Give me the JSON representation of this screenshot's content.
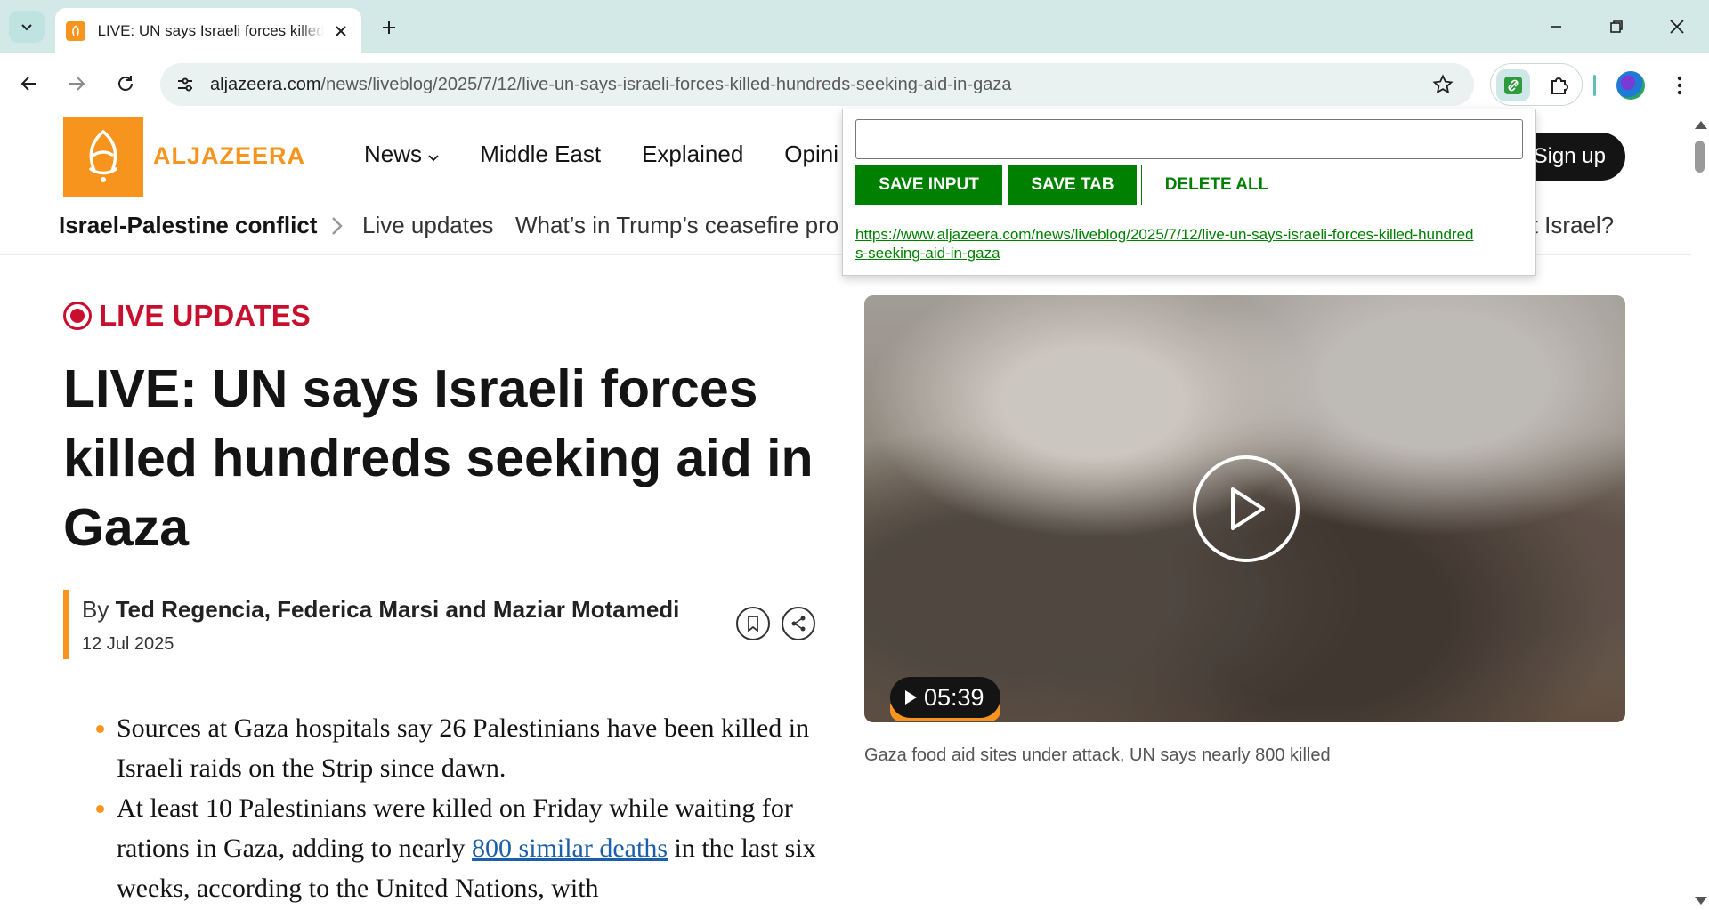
{
  "browser": {
    "tab": {
      "title": "LIVE: UN says Israeli forces killed hundreds seeking aid in Gaza"
    },
    "url": {
      "host": "aljazeera.com",
      "path": "/news/liveblog/2025/7/12/live-un-says-israeli-forces-killed-hundreds-seeking-aid-in-gaza"
    }
  },
  "site": {
    "logo_text": "ALJAZEERA",
    "nav": [
      "News",
      "Middle East",
      "Explained",
      "Opini"
    ],
    "signup": "Sign up"
  },
  "breadcrumb": {
    "topic": "Israel-Palestine conflict",
    "items": [
      "Live updates",
      "What’s in Trump’s ceasefire pro",
      "rt Israel?"
    ]
  },
  "article": {
    "live_label": "LIVE UPDATES",
    "headline": "LIVE: UN says Israeli forces killed hundreds seeking aid in Gaza",
    "by_prefix": "By",
    "authors": "Ted Regencia, Federica Marsi and Maziar Motamedi",
    "date": "12 Jul 2025",
    "bullets": [
      {
        "text": "Sources at Gaza hospitals say 26 Palestinians have been killed in Israeli raids on the Strip since dawn."
      },
      {
        "before": "At least 10 Palestinians were killed on Friday while waiting for rations in Gaza, adding to nearly ",
        "link": "800 similar deaths",
        "after": " in the last six weeks, according to the United Nations, with"
      }
    ]
  },
  "video": {
    "duration": "05:39",
    "caption": "Gaza food aid sites under attack, UN says nearly 800 killed"
  },
  "popup": {
    "input_value": "",
    "save_input": "SAVE INPUT",
    "save_tab": "SAVE TAB",
    "delete_all": "DELETE ALL",
    "saved_link": "https://www.aljazeera.com/news/liveblog/2025/7/12/live-un-says-israeli-forces-killed-hundreds-seeking-aid-in-gaza"
  }
}
